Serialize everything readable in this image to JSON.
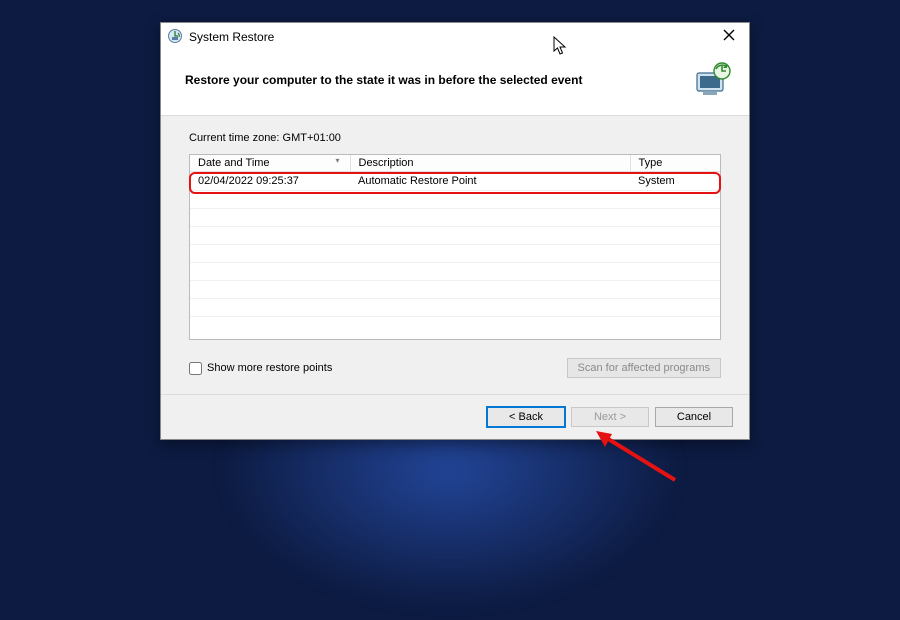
{
  "window": {
    "title": "System Restore"
  },
  "header": {
    "headline": "Restore your computer to the state it was in before the selected event"
  },
  "timezone_label": "Current time zone: GMT+01:00",
  "table": {
    "columns": {
      "datetime": "Date and Time",
      "description": "Description",
      "type": "Type"
    },
    "rows": [
      {
        "datetime": "02/04/2022 09:25:37",
        "description": "Automatic Restore Point",
        "type": "System"
      }
    ]
  },
  "show_more_label": "Show more restore points",
  "scan_label": "Scan for affected programs",
  "buttons": {
    "back": "< Back",
    "next": "Next >",
    "cancel": "Cancel"
  }
}
